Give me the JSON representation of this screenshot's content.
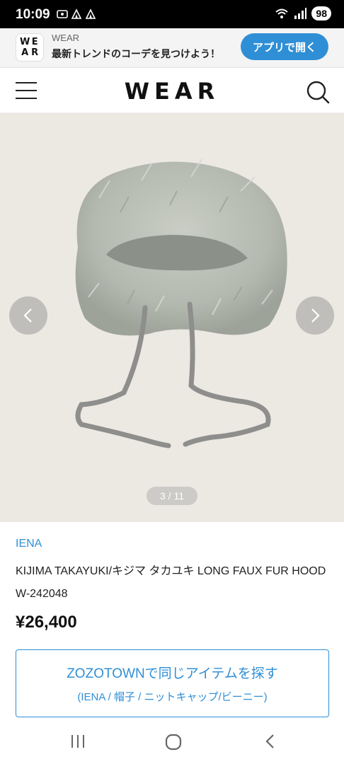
{
  "status_bar": {
    "time": "10:09",
    "battery": "98"
  },
  "app_banner": {
    "logo_letters": [
      "W",
      "E",
      "A",
      "R"
    ],
    "app_name": "WEAR",
    "tagline": "最新トレンドのコーデを見つけよう！",
    "open_button": "アプリで開く",
    "accent_color": "#2f8fd6"
  },
  "header": {
    "logo": "WEAR",
    "menu_icon": "hamburger-menu-icon",
    "search_icon": "search-icon"
  },
  "gallery": {
    "counter": "3 / 11",
    "current_image": 3,
    "total_images": 11,
    "prev_icon": "chevron-left-icon",
    "next_icon": "chevron-right-icon"
  },
  "product": {
    "brand": "IENA",
    "title": "KIJIMA TAKAYUKI/キジマ タカユキ LONG FAUX FUR HOOD W-242048",
    "price": "¥26,400"
  },
  "zozo": {
    "main_label": "ZOZOTOWNで同じアイテムを探す",
    "sub_label": "(IENA / 帽子 / ニットキャップ/ビーニー)"
  },
  "nav_bar": {
    "icons": [
      "recent-apps-icon",
      "home-icon",
      "back-icon"
    ]
  }
}
